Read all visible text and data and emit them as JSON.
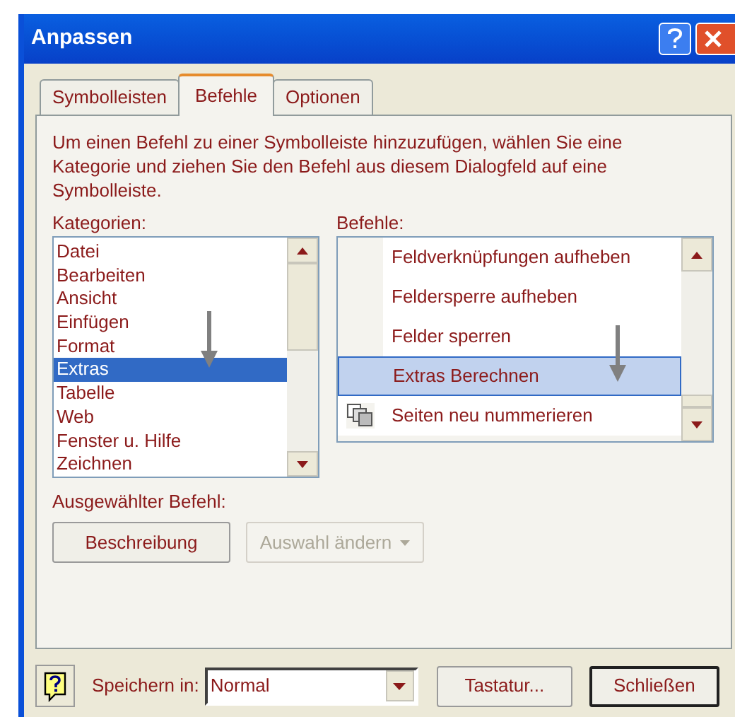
{
  "window": {
    "title": "Anpassen"
  },
  "tabs": [
    {
      "label": "Symbolleisten",
      "selected": false
    },
    {
      "label": "Befehle",
      "selected": true
    },
    {
      "label": "Optionen",
      "selected": false
    }
  ],
  "description": "Um einen Befehl zu einer Symbolleiste hinzuzufügen, wählen Sie eine Kategorie und ziehen Sie den Befehl aus diesem Dialogfeld auf eine Symbolleiste.",
  "categories": {
    "label": "Kategorien:",
    "items": [
      {
        "label": "Datei",
        "selected": false
      },
      {
        "label": "Bearbeiten",
        "selected": false
      },
      {
        "label": "Ansicht",
        "selected": false
      },
      {
        "label": "Einfügen",
        "selected": false
      },
      {
        "label": "Format",
        "selected": false
      },
      {
        "label": "Extras",
        "selected": true
      },
      {
        "label": "Tabelle",
        "selected": false
      },
      {
        "label": "Web",
        "selected": false
      },
      {
        "label": "Fenster u. Hilfe",
        "selected": false
      },
      {
        "label": "Zeichnen",
        "selected": false
      }
    ]
  },
  "commands": {
    "label": "Befehle:",
    "items": [
      {
        "label": "Feldverknüpfungen aufheben",
        "selected": false,
        "has_icon": false
      },
      {
        "label": "Feldersperre aufheben",
        "selected": false,
        "has_icon": false
      },
      {
        "label": "Felder sperren",
        "selected": false,
        "has_icon": false
      },
      {
        "label": "Extras Berechnen",
        "selected": true,
        "has_icon": false
      },
      {
        "label": "Seiten neu nummerieren",
        "selected": false,
        "has_icon": true
      }
    ]
  },
  "selected_command": {
    "label": "Ausgewählter Befehl:",
    "buttons": [
      {
        "label": "Beschreibung",
        "disabled": false,
        "dropdown": false
      },
      {
        "label": "Auswahl ändern",
        "disabled": true,
        "dropdown": true
      }
    ]
  },
  "footer": {
    "save_in": {
      "label": "Speichern in:",
      "value": "Normal"
    },
    "buttons": [
      {
        "label": "Tastatur...",
        "default": false
      },
      {
        "label": "Schließen",
        "default": true
      }
    ]
  }
}
